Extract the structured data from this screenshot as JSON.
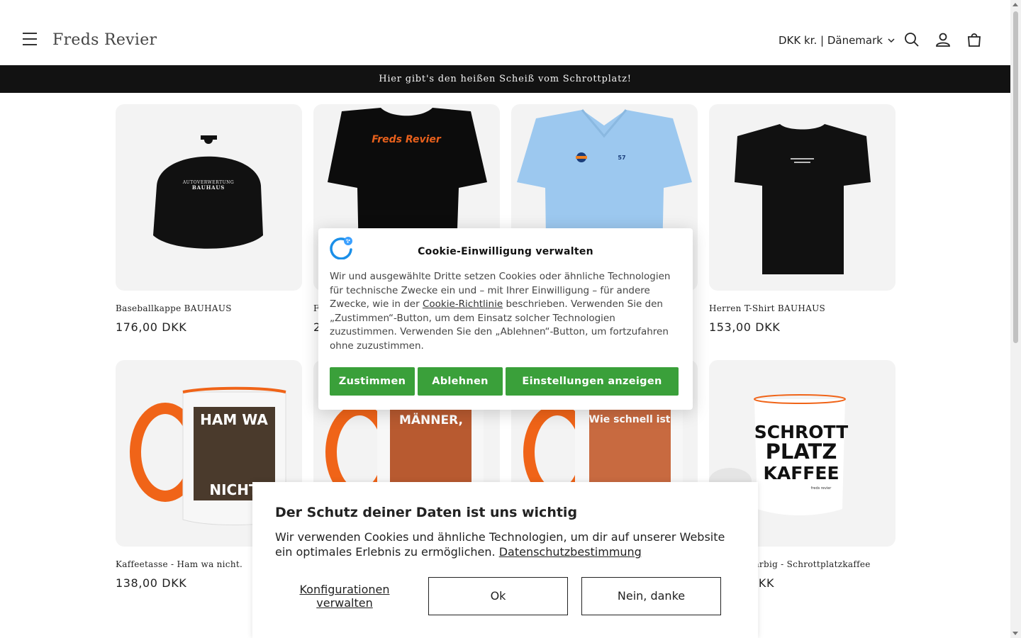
{
  "header": {
    "brand": "Freds Revier",
    "locale": "DKK kr. | Dänemark",
    "announcement": "Hier gibt's den heißen Scheiß vom Schrottplatz!"
  },
  "products": [
    {
      "title": "Baseballkappe BAUHAUS",
      "price": "176,00 DKK",
      "cap_text_1": "AUTOVERWERTUNG",
      "cap_text_2": "BAUHAUS"
    },
    {
      "title": "F",
      "price": "2",
      "shirt_text": "Freds Revier"
    },
    {
      "title": "",
      "price": "",
      "badge": "57"
    },
    {
      "title": "Herren T-Shirt BAUHAUS",
      "price": "153,00 DKK"
    },
    {
      "title": "Kaffeetasse - Ham wa nicht.",
      "price": "138,00 DKK",
      "mug_top": "HAM WA",
      "mug_bottom": "NICHT"
    },
    {
      "title": "",
      "price": "",
      "mug_top": "MÄNNER,"
    },
    {
      "title": "",
      "price": "",
      "mug_top": "Wie schnell ist"
    },
    {
      "title": "zweifarbig - Schrottplatzkaffee",
      "price": "DKK",
      "mug_lines": [
        "SCHROTT",
        "PLATZ",
        "KAFFEE"
      ],
      "mug_small": "freds revier"
    }
  ],
  "cookie_modal": {
    "title": "Cookie-Einwilligung verwalten",
    "text_before_link": "Wir und ausgewählte Dritte setzen Cookies oder ähnliche Technologien für technische Zwecke ein und – mit Ihrer Einwilligung – für andere Zwecke, wie in der ",
    "link": "Cookie-Richtlinie",
    "text_after_link": " beschrieben. Verwenden Sie den „Zustimmen“-Button, um dem Einsatz solcher Technologien zuzustimmen. Verwenden Sie den „Ablehnen“-Button, um fortzufahren ohne zuzustimmen.",
    "accept": "Zustimmen",
    "reject": "Ablehnen",
    "settings": "Einstellungen anzeigen",
    "accent": "#3aa03a"
  },
  "privacy_banner": {
    "title": "Der Schutz deiner Daten ist uns wichtig",
    "text": "Wir verwenden Cookies und ähnliche Technologien, um dir auf unserer Website ein optimales Erlebnis zu ermöglichen. ",
    "link": "Datenschutzbestimmung",
    "config": "Konfigurationen verwalten",
    "ok": "Ok",
    "no": "Nein, danke"
  },
  "icons": {
    "menu": "hamburger-icon",
    "search": "search-icon",
    "account": "user-icon",
    "cart": "cart-icon",
    "locale_dropdown": "chevron-down-icon"
  }
}
